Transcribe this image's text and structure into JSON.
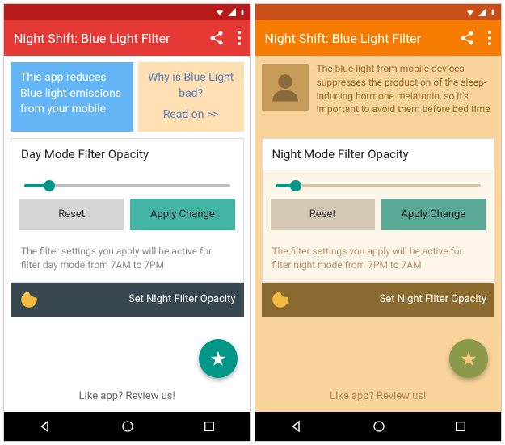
{
  "left": {
    "app_title": "Night Shift: Blue Light Filter",
    "info_blue": "This app reduces Blue light emissions from your mobile",
    "info_beige_title": "Why is Blue Light bad?",
    "info_beige_link": "Read on >>",
    "card_title": "Day Mode Filter Opacity",
    "slider_pct": 12,
    "reset": "Reset",
    "apply": "Apply Change",
    "desc": "The filter settings you apply will be active for filter day mode from 7AM to 7PM",
    "night_label": "Set Night Filter Opacity",
    "review": "Like app? Review us!"
  },
  "right": {
    "app_title": "Night Shift: Blue Light Filter",
    "info_text": "The blue light from mobile devices suppresses the production of the sleep-inducing hormone melatonin, so it's important to avoid them before bed time",
    "card_title": "Night Mode Filter Opacity",
    "slider_pct": 10,
    "reset": "Reset",
    "apply": "Apply Change",
    "desc": "The filter settings you apply will be active for filter night mode from 7PM to 7AM",
    "night_label": "Set Night Filter Opacity",
    "review": "Like app? Review us!"
  }
}
